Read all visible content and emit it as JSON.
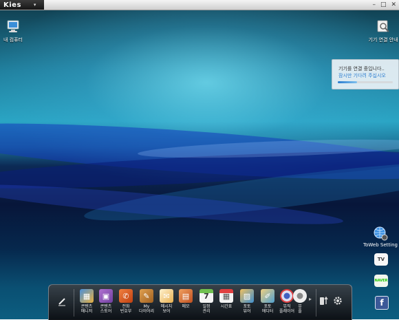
{
  "window": {
    "app_title": "Kies",
    "menu_caret": "▾",
    "minimize": "–",
    "maximize": "□",
    "close": "✕"
  },
  "desktop": {
    "my_computer_label": "내 컴퓨터",
    "connection_guide_label": "기기 연결 안내"
  },
  "status": {
    "line1": "기기를 연결 중입니다..",
    "line2": "잠시만 기다려 주십시오",
    "progress_fraction": 0.35
  },
  "sidebar": {
    "toweb_label": "ToWeb Setting",
    "tv_badge": "TV",
    "naver_badge": "NAVER",
    "facebook_badge": "f"
  },
  "dock": {
    "items": [
      {
        "l1": "콘텐츠",
        "l2": "매니저"
      },
      {
        "l1": "콘텐츠",
        "l2": "스토어"
      },
      {
        "l1": "전화",
        "l2": "번호부"
      },
      {
        "l1": "My",
        "l2": "다이어리"
      },
      {
        "l1": "메시지",
        "l2": "보어"
      },
      {
        "l1": "메모",
        "l2": ""
      },
      {
        "l1": "일정",
        "l2": "관리"
      },
      {
        "l1": "시간표",
        "l2": ""
      },
      {
        "l1": "포토",
        "l2": "뷰어"
      },
      {
        "l1": "포토",
        "l2": "에디터"
      },
      {
        "l1": "뮤직",
        "l2": "플레이어"
      },
      {
        "l1": "뮤",
        "l2": "플"
      }
    ],
    "calendar_day": "7",
    "more_arrow": "▸"
  },
  "colors": {
    "accent": "#2a7ccf",
    "dock_bg": "#1a1c20",
    "panel_bg": "#f0f4f8"
  }
}
